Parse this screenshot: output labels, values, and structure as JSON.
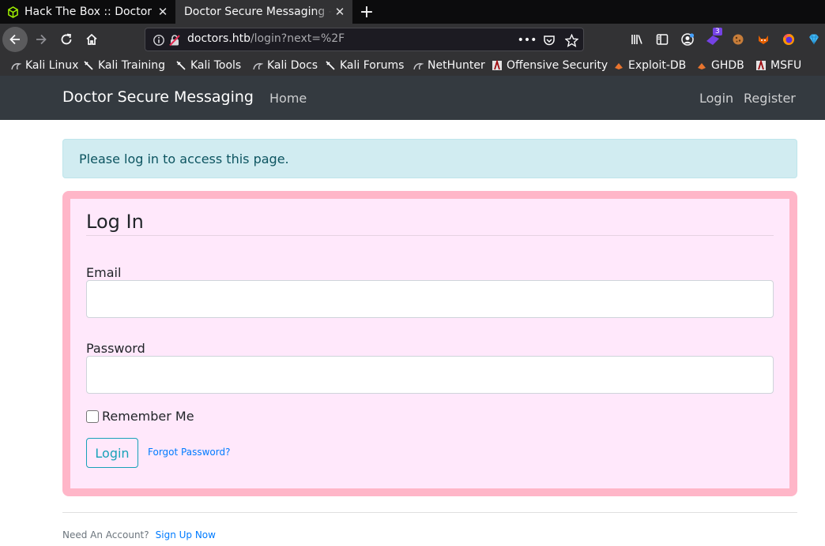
{
  "browser": {
    "tabs": [
      {
        "title": "Hack The Box :: Doctor",
        "active": false,
        "icon": "cube-icon"
      },
      {
        "title": "Doctor Secure Messaging - D",
        "active": true,
        "icon": ""
      }
    ],
    "url": {
      "host": "doctors.htb",
      "path": "/login?next=%2F"
    },
    "extension_badge": "3",
    "bookmarks": [
      {
        "label": "Kali Linux",
        "icon": "kali-dragon-icon"
      },
      {
        "label": "Kali Training",
        "icon": "kali-sword-icon"
      },
      {
        "label": "Kali Tools",
        "icon": "kali-sword-icon"
      },
      {
        "label": "Kali Docs",
        "icon": "kali-dragon-icon"
      },
      {
        "label": "Kali Forums",
        "icon": "kali-sword-icon"
      },
      {
        "label": "NetHunter",
        "icon": "kali-dragon-icon"
      },
      {
        "label": "Offensive Security",
        "icon": "offsec-icon"
      },
      {
        "label": "Exploit-DB",
        "icon": "exploitdb-icon"
      },
      {
        "label": "GHDB",
        "icon": "exploitdb-icon"
      },
      {
        "label": "MSFU",
        "icon": "offsec-icon"
      }
    ]
  },
  "site": {
    "brand": "Doctor Secure Messaging",
    "nav": {
      "home": "Home",
      "login": "Login",
      "register": "Register"
    },
    "alert": "Please log in to access this page.",
    "form": {
      "legend": "Log In",
      "email_label": "Email",
      "email_value": "",
      "password_label": "Password",
      "password_value": "",
      "remember_label": "Remember Me",
      "remember_checked": false,
      "submit_label": "Login",
      "forgot_label": "Forgot Password?"
    },
    "footer": {
      "text": "Need An Account?",
      "link": "Sign Up Now"
    }
  },
  "colors": {
    "navbar_bg": "#343a40",
    "alert_bg": "#d1ecf1",
    "alert_text": "#0c5460",
    "card_bg": "#ffe8fb",
    "card_border": "#ffb6c8",
    "login_button": "#17a2b8",
    "link": "#007bff"
  }
}
